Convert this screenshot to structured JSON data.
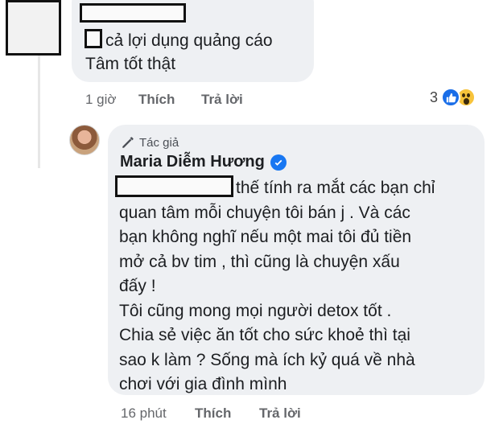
{
  "comment": {
    "text_lines": [
      "cả lợi dụng quảng cáo",
      "Tâm tốt thật"
    ],
    "time": "1 giờ",
    "like_label": "Thích",
    "reply_label": "Trả lời",
    "reaction_count": "3",
    "reactions": [
      "like-icon",
      "wow-icon"
    ]
  },
  "reply": {
    "badge": "Tác giả",
    "author": "Maria Diễm Hương",
    "text_lines": [
      "thế tính ra mắt các bạn chỉ",
      "quan tâm mỗi chuyện tôi bán j . Và các",
      "bạn không nghĩ nếu một mai tôi đủ tiền",
      "mở cả bv tim , thì cũng là chuyện xấu",
      "đấy !",
      "Tôi cũng mong mọi người detox tốt .",
      "Chia sẻ việc ăn tốt cho sức khoẻ thì tại",
      "sao k làm ? Sống mà ích kỷ quá về nhà",
      "chơi với gia đình mình"
    ],
    "time": "16 phút",
    "like_label": "Thích",
    "reply_label": "Trả lời"
  },
  "colors": {
    "bubble": "#eef0f3",
    "meta_text": "#65676b",
    "verified": "#1877f2",
    "like_reaction": "#1a6ee8",
    "wow_reaction": "#f7c33b"
  }
}
